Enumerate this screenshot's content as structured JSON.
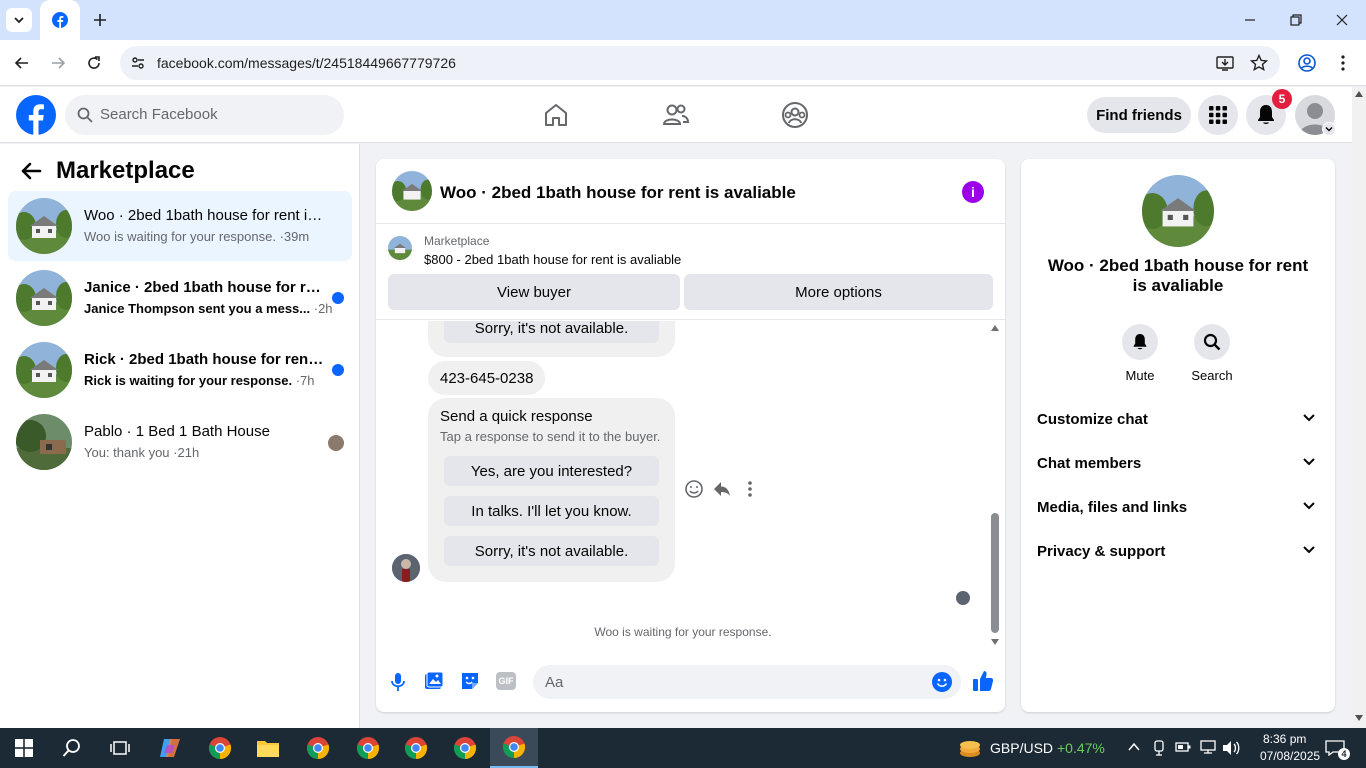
{
  "browser": {
    "url": "facebook.com/messages/t/24518449667779726"
  },
  "fb_header": {
    "search_placeholder": "Search Facebook",
    "find_friends": "Find friends",
    "notif_count": "5"
  },
  "left_panel": {
    "title": "Marketplace",
    "conversations": [
      {
        "title": "Woo · 2bed 1bath house for rent is...",
        "subtitle": "Woo is waiting for your response.",
        "time": "·39m",
        "unread": false
      },
      {
        "title": "Janice · 2bed 1bath house for ren...",
        "subtitle": "Janice Thompson sent you a mess...",
        "time": "·2h",
        "unread": true
      },
      {
        "title": "Rick · 2bed 1bath house for rent ...",
        "subtitle": "Rick is waiting for your response.",
        "time": "·7h",
        "unread": true
      },
      {
        "title": "Pablo · 1 Bed 1 Bath House",
        "subtitle": "You: thank you",
        "time": "·21h",
        "unread": false
      }
    ]
  },
  "chat": {
    "title": "Woo · 2bed 1bath house for rent is avaliable",
    "listing_label": "Marketplace",
    "listing_title": "$800 - 2bed 1bath house for rent is avaliable",
    "view_buyer": "View buyer",
    "more_options": "More options",
    "prev_reply": "Sorry, it's not available.",
    "phone": "423-645-0238",
    "quick_title": "Send a quick response",
    "quick_sub": "Tap a response to send it to the buyer.",
    "quick_options": [
      "Yes, are you interested?",
      "In talks. I'll let you know.",
      "Sorry, it's not available."
    ],
    "waiting": "Woo is waiting for your response.",
    "composer_placeholder": "Aa"
  },
  "right_panel": {
    "title": "Woo · 2bed 1bath house for rent is avaliable",
    "mute": "Mute",
    "search": "Search",
    "sections": [
      "Customize chat",
      "Chat members",
      "Media, files and links",
      "Privacy & support"
    ]
  },
  "taskbar": {
    "ticker": "GBP/USD",
    "ticker_change": "+0.47%",
    "time": "8:36 pm",
    "date": "07/08/2025",
    "notif": "4"
  },
  "colors": {
    "fb_blue": "#0866ff",
    "info_purple": "#9b00e8",
    "badge_red": "#e41e3f"
  }
}
